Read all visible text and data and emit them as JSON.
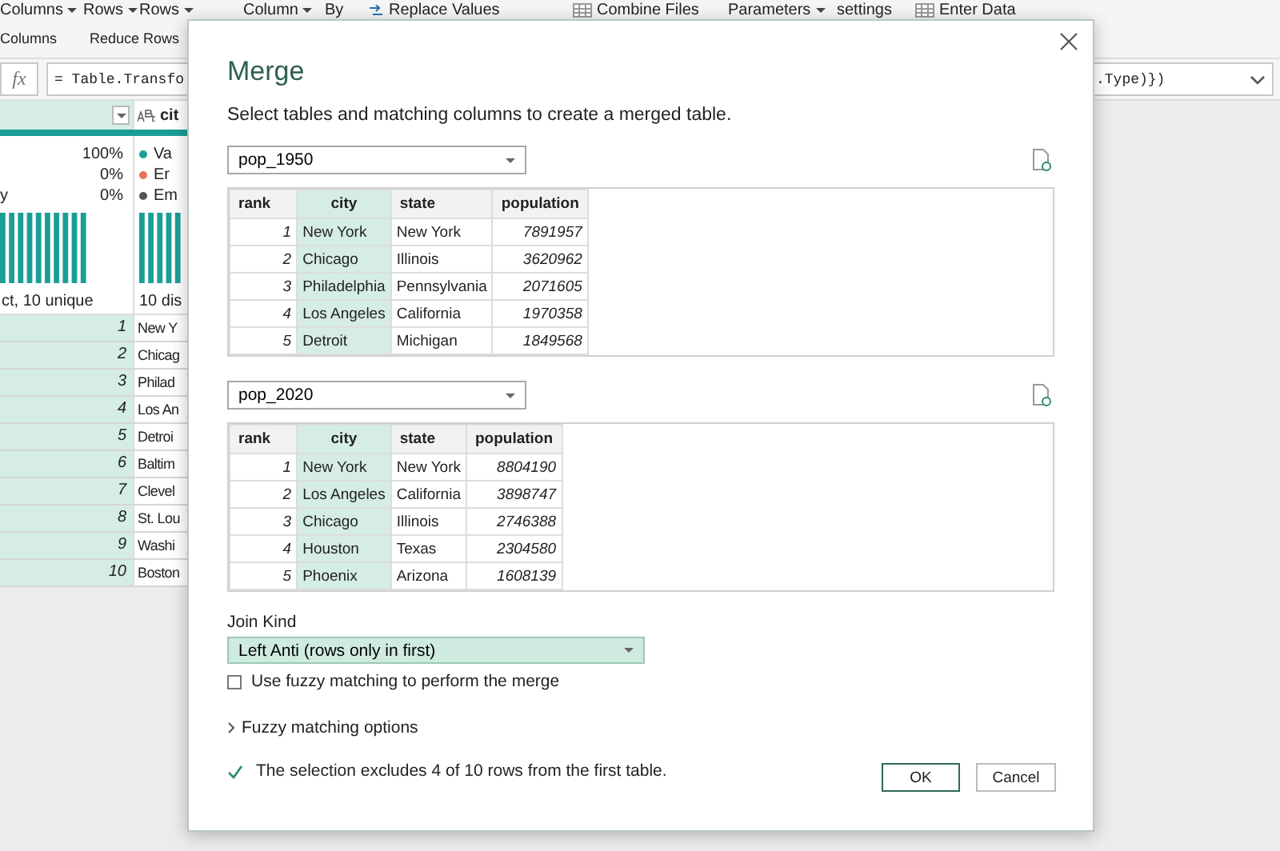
{
  "ribbon": {
    "row_1": [
      {
        "label": "Columns",
        "caret": true,
        "kind": "plain"
      },
      {
        "label": "Rows",
        "caret": true,
        "kind": "plain"
      },
      {
        "label": "Rows",
        "caret": true,
        "kind": "plain"
      },
      {
        "label": "Column",
        "caret": true,
        "kind": "plain"
      },
      {
        "label": "By",
        "caret": false,
        "kind": "plain"
      },
      {
        "label": "Replace Values",
        "caret": false,
        "kind": "replace"
      },
      {
        "label": "Combine Files",
        "caret": false,
        "kind": "table"
      },
      {
        "label": "Parameters",
        "caret": true,
        "kind": "plain"
      },
      {
        "label": "settings",
        "caret": false,
        "kind": "plain"
      },
      {
        "label": "Enter Data",
        "caret": false,
        "kind": "table"
      }
    ],
    "row_2": [
      "Columns",
      "Reduce Rows"
    ]
  },
  "formula_bar": {
    "fx_label": "fx",
    "formula_start": "= Table.Transfo",
    "formula_end": ".Type)})"
  },
  "grid": {
    "columns": [
      {
        "selected": true
      },
      {
        "name": "cit",
        "selected": false
      }
    ],
    "profile_1": [
      {
        "value": "100%"
      },
      {
        "value": "0%"
      },
      {
        "label": "y",
        "value": "0%"
      }
    ],
    "profile_2": [
      {
        "label": "Va",
        "color": "#1a9e96"
      },
      {
        "label": "Er",
        "color": "#e8735a"
      },
      {
        "label": "Em",
        "color": "#555555"
      }
    ],
    "footer_1": "ct, 10 unique",
    "footer_2": "10 dis",
    "rows": [
      [
        "1",
        "New Y"
      ],
      [
        "2",
        "Chicag"
      ],
      [
        "3",
        "Philad"
      ],
      [
        "4",
        "Los An"
      ],
      [
        "5",
        "Detroi"
      ],
      [
        "6",
        "Baltim"
      ],
      [
        "7",
        "Clevel"
      ],
      [
        "8",
        "St. Lou"
      ],
      [
        "9",
        "Washi"
      ],
      [
        "10",
        "Boston"
      ]
    ]
  },
  "dialog": {
    "title": "Merge",
    "subtitle": "Select tables and matching columns to create a merged table.",
    "tables": [
      {
        "source": "pop_1950",
        "columns": [
          {
            "name": "rank",
            "selected": false
          },
          {
            "name": "city",
            "selected": true
          },
          {
            "name": "state",
            "selected": false
          },
          {
            "name": "population",
            "selected": false
          }
        ],
        "rows": [
          [
            "1",
            "New York",
            "New York",
            "7891957"
          ],
          [
            "2",
            "Chicago",
            "Illinois",
            "3620962"
          ],
          [
            "3",
            "Philadelphia",
            "Pennsylvania",
            "2071605"
          ],
          [
            "4",
            "Los Angeles",
            "California",
            "1970358"
          ],
          [
            "5",
            "Detroit",
            "Michigan",
            "1849568"
          ]
        ]
      },
      {
        "source": "pop_2020",
        "columns": [
          {
            "name": "rank",
            "selected": false
          },
          {
            "name": "city",
            "selected": true
          },
          {
            "name": "state",
            "selected": false
          },
          {
            "name": "population",
            "selected": false
          }
        ],
        "rows": [
          [
            "1",
            "New York",
            "New York",
            "8804190"
          ],
          [
            "2",
            "Los Angeles",
            "California",
            "3898747"
          ],
          [
            "3",
            "Chicago",
            "Illinois",
            "2746388"
          ],
          [
            "4",
            "Houston",
            "Texas",
            "2304580"
          ],
          [
            "5",
            "Phoenix",
            "Arizona",
            "1608139"
          ]
        ]
      }
    ],
    "join_kind": {
      "label": "Join Kind",
      "value": "Left Anti (rows only in first)"
    },
    "fuzzy_checkbox": {
      "label": "Use fuzzy matching to perform the merge",
      "checked": false
    },
    "fuzzy_options": {
      "label": "Fuzzy matching options",
      "expanded": false
    },
    "status": "The selection excludes 4 of 10 rows from the first table.",
    "buttons": [
      {
        "label": "OK",
        "default": true
      },
      {
        "label": "Cancel",
        "default": false
      }
    ]
  }
}
